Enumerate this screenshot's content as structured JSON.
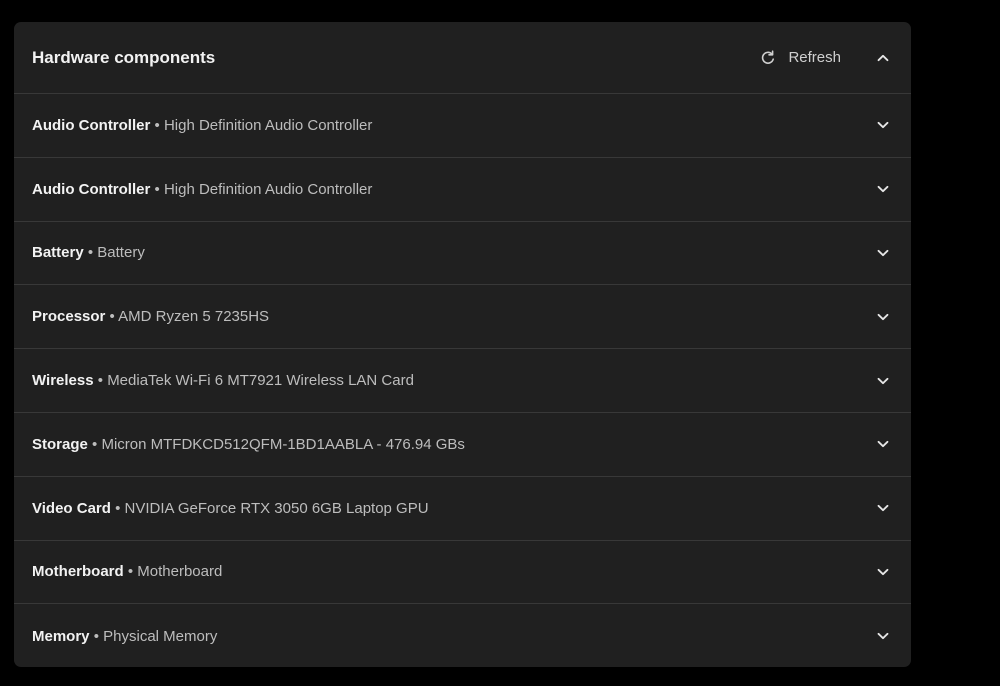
{
  "header": {
    "title": "Hardware components",
    "refresh_label": "Refresh",
    "refresh_icon": "refresh-icon",
    "collapse_icon": "chevron-up-icon"
  },
  "separator": "•",
  "components": [
    {
      "name": "Audio Controller",
      "detail": "High Definition Audio Controller"
    },
    {
      "name": "Audio Controller",
      "detail": "High Definition Audio Controller"
    },
    {
      "name": "Battery",
      "detail": "Battery"
    },
    {
      "name": "Processor",
      "detail": "AMD Ryzen 5 7235HS"
    },
    {
      "name": "Wireless",
      "detail": "MediaTek Wi-Fi 6 MT7921 Wireless LAN Card"
    },
    {
      "name": "Storage",
      "detail": "Micron MTFDKCD512QFM-1BD1AABLA - 476.94 GBs"
    },
    {
      "name": "Video Card",
      "detail": "NVIDIA GeForce RTX 3050 6GB Laptop GPU"
    },
    {
      "name": "Motherboard",
      "detail": "Motherboard"
    },
    {
      "name": "Memory",
      "detail": "Physical Memory"
    }
  ],
  "colors": {
    "background": "#000000",
    "panel": "#202020",
    "divider": "#383838",
    "text_primary": "#f2f2f2",
    "text_secondary": "#bdbdbd"
  }
}
